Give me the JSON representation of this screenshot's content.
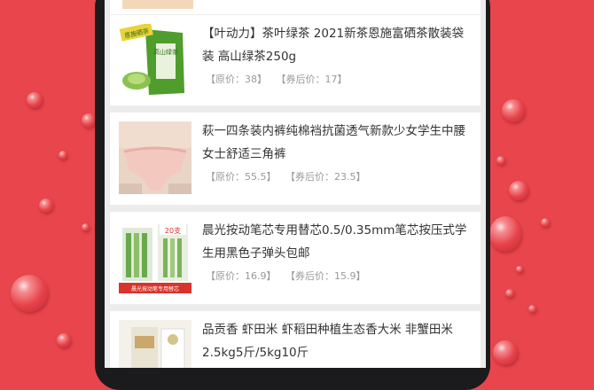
{
  "products": [
    {
      "title": "【叶动力】茶叶绿茶 2021新茶恩施富硒茶散装袋装 高山绿茶250g",
      "original_price": "【原价：38】",
      "coupon_price": "【券后价：17】",
      "thumb_icon": "green-tea-bag-image",
      "thumb_label": "恩施硒茶",
      "thumb_badge": "高山绿茶"
    },
    {
      "title": "萩一四条装内裤纯棉裆抗菌透气新款少女学生中腰女士舒适三角裤",
      "original_price": "【原价：55.5】",
      "coupon_price": "【券后价：23.5】",
      "thumb_icon": "underwear-photo-image"
    },
    {
      "title": "晨光按动笔芯专用替芯0.5/0.35mm笔芯按压式学生用黑色子弹头包邮",
      "original_price": "【原价：16.9】",
      "coupon_price": "【券后价：15.9】",
      "thumb_icon": "pen-refill-pack-image",
      "thumb_label": "20支",
      "thumb_badge": "晨光按动笔专用替芯"
    },
    {
      "title": "品贡香 虾田米 虾稻田种植生态香大米 非蟹田米 2.5kg5斤/5kg10斤",
      "thumb_icon": "rice-bag-image"
    }
  ],
  "colors": {
    "background": "#e8454d",
    "card": "#ffffff",
    "screen": "#ececec",
    "text": "#333333",
    "price_text": "#9a9a9a"
  }
}
